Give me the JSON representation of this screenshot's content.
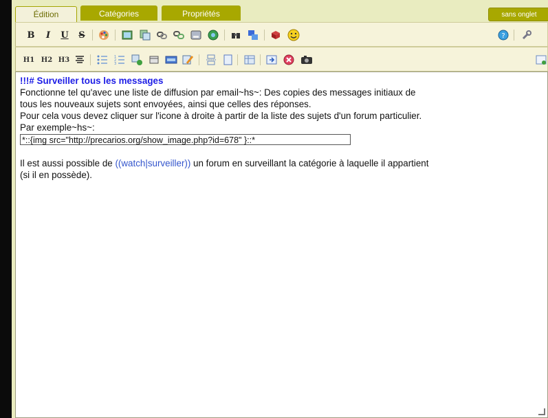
{
  "tabs": [
    {
      "label": "Édition"
    },
    {
      "label": "Catégories"
    },
    {
      "label": "Propriétés"
    }
  ],
  "sans_onglet": "sans onglet",
  "toolbar1": {
    "bold": "B",
    "italic": "I",
    "underline": "U",
    "strike": "S"
  },
  "toolbar2": {
    "h1": "H1",
    "h2": "H2",
    "h3": "H3"
  },
  "editor": {
    "heading": "!!!# Surveiller tous les messages",
    "p1_l1": "Fonctionne tel qu'avec une liste de diffusion par email~hs~: Des copies des messages initiaux de",
    "p1_l2": "tous les nouveaux sujets sont envoyées, ainsi que celles des réponses.",
    "p2": "Pour cela vous devez cliquer sur l'icone à droite à partir de la liste des sujets d'un forum particulier.",
    "p3": "Par exemple~hs~:",
    "img_code": "*::{img src=\"http://precarios.org/show_image.php?id=678\" }::*",
    "p4_before": "Il est aussi possible de ",
    "p4_link": "((watch|surveiller))",
    "p4_after": " un forum en surveillant la catégorie à laquelle il appartient",
    "p4_l2": "(si il en possède)."
  },
  "colors": {
    "tab_active": "#f3f1da",
    "tab_inactive": "#a8a800",
    "toolbar_bg": "#f6f3da",
    "heading": "#1c1ce6",
    "link": "#3355cc"
  }
}
